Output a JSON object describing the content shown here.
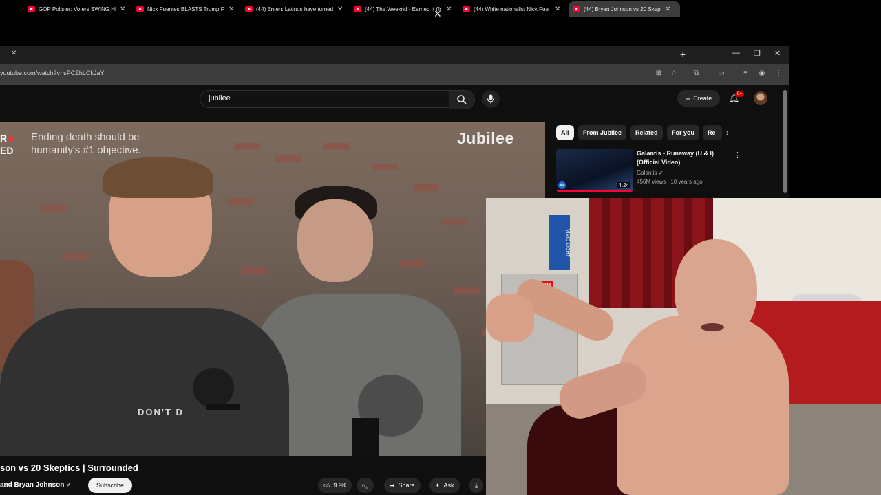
{
  "browser": {
    "tabs": [
      {
        "title": "GOP Pollster: Voters SWING HE"
      },
      {
        "title": "Nick Fuentes BLASTS Trump Fo"
      },
      {
        "title": "(44) Enten: Latinos have turned"
      },
      {
        "title": "(44) The Weeknd - Earned It (fr"
      },
      {
        "title": "(44) White nationalist Nick Fue"
      },
      {
        "title": "(44) Bryan Johnson vs 20 Skept"
      }
    ],
    "url": "youtube.com/watch?v=sPCZhLCkJaY"
  },
  "youtube": {
    "search_value": "jubilee",
    "create_label": "Create",
    "notification_badge": "9+",
    "video_overlay": {
      "logo_line1": "R",
      "logo_line2": "ED",
      "tagline_line1": "Ending death should be",
      "tagline_line2": "humanity's #1 objective.",
      "brand": "Jubilee",
      "shirt_text": "DON'T D"
    },
    "video_title": "son vs 20 Skeptics | Surrounded",
    "channel_text": "and Bryan Johnson",
    "subscribe_label": "Subscribe",
    "actions": {
      "likes": "9.9K",
      "share": "Share",
      "ask": "Ask"
    },
    "chips": [
      "All",
      "From Jubilee",
      "Related",
      "For you",
      "Re"
    ],
    "recommendation": {
      "title": "Galantis - Runaway (U & I) (Official Video)",
      "channel": "Galantis",
      "meta": "456M views · 10 years ago",
      "duration": "4:24"
    }
  },
  "webcam": {
    "sticker": "Supreme",
    "box_text": "VIVID LIGHT"
  }
}
